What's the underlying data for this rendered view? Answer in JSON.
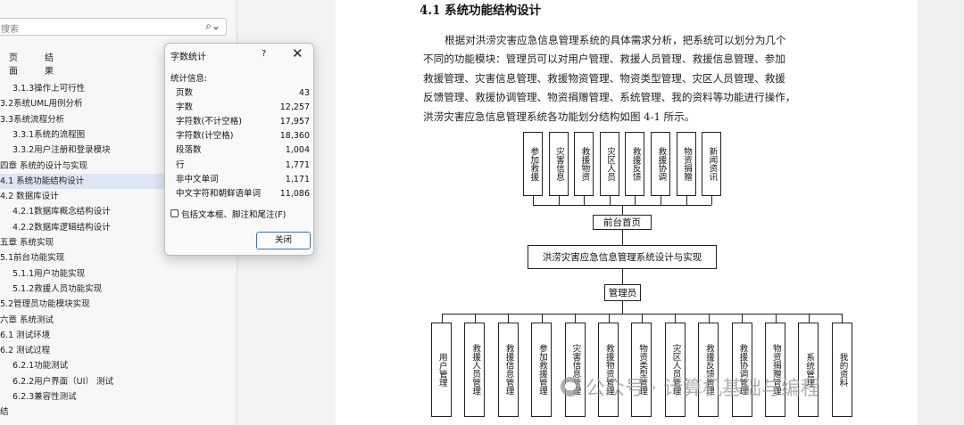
{
  "nav": {
    "search_placeholder": "搜索",
    "tabs": [
      "页面",
      "结果"
    ],
    "items": [
      {
        "label": "3.1.3操作上可行性",
        "indent": 14,
        "selected": false
      },
      {
        "label": "3.2系统UML用例分析",
        "indent": 0,
        "selected": false
      },
      {
        "label": "3.3系统流程分析",
        "indent": 0,
        "selected": false
      },
      {
        "label": "3.3.1系统的流程图",
        "indent": 14,
        "selected": false
      },
      {
        "label": "3.3.2用户注册和登录模块",
        "indent": 14,
        "selected": false
      },
      {
        "label": "四章 系统的设计与实现",
        "indent": 0,
        "selected": false
      },
      {
        "label": "4.1 系统功能结构设计",
        "indent": 0,
        "selected": true
      },
      {
        "label": "4.2 数据库设计",
        "indent": 0,
        "selected": false
      },
      {
        "label": "4.2.1数据库概念结构设计",
        "indent": 14,
        "selected": false
      },
      {
        "label": "4.2.2数据库逻辑结构设计",
        "indent": 14,
        "selected": false
      },
      {
        "label": "五章 系统实现",
        "indent": 0,
        "selected": false
      },
      {
        "label": "5.1前台功能实现",
        "indent": 0,
        "selected": false
      },
      {
        "label": "5.1.1用户功能实现",
        "indent": 14,
        "selected": false
      },
      {
        "label": "5.1.2救援人员功能实现",
        "indent": 14,
        "selected": false
      },
      {
        "label": "5.2管理员功能模块实现",
        "indent": 0,
        "selected": false
      },
      {
        "label": "六章 系统测试",
        "indent": 0,
        "selected": false
      },
      {
        "label": "6.1 测试环境",
        "indent": 0,
        "selected": false
      },
      {
        "label": "6.2 测试过程",
        "indent": 0,
        "selected": false
      },
      {
        "label": "6.2.1功能测试",
        "indent": 14,
        "selected": false
      },
      {
        "label": "6.2.2用户界面（UI） 测试",
        "indent": 14,
        "selected": false
      },
      {
        "label": "6.2.3兼容性测试",
        "indent": 14,
        "selected": false
      },
      {
        "label": "结",
        "indent": 0,
        "selected": false
      }
    ]
  },
  "dialog": {
    "title": "字数统计",
    "help": "?",
    "close": "✕",
    "section": "统计信息:",
    "stats": [
      {
        "label": "页数",
        "value": "43"
      },
      {
        "label": "字数",
        "value": "12,257"
      },
      {
        "label": "字符数(不计空格)",
        "value": "17,957"
      },
      {
        "label": "字符数(计空格)",
        "value": "18,360"
      },
      {
        "label": "段落数",
        "value": "1,004"
      },
      {
        "label": "行",
        "value": "1,771"
      },
      {
        "label": "非中文单词",
        "value": "1,171"
      },
      {
        "label": "中文字符和朝鲜语单词",
        "value": "11,086"
      }
    ],
    "checkbox_label": "包括文本框、脚注和尾注(F)",
    "checkbox_checked": false,
    "close_button": "关闭"
  },
  "document": {
    "heading": "4.1  系统功能结构设计",
    "paragraph_lines": [
      "根据对洪涝灾害应急信息管理系统的具体需求分析，把系统可以划分为几个",
      "不同的功能模块：管理员可以对用户管理、救援人员管理、救援信息管理、参加",
      "救援管理、灾害信息管理、救援物资管理、物资类型管理、灾区人员管理、救援",
      "反馈管理、救援协调管理、物资捐赠管理、系统管理、我的资料等功能进行操作，",
      "洪涝灾害应急信息管理系统各功能划分结构如图 4-1 所示。"
    ]
  },
  "diagram": {
    "top_modules": [
      "参加救援",
      "灾害信息",
      "救援物资",
      "灾区人员",
      "救援反馈",
      "救援协调",
      "物资捐赠",
      "新闻资讯"
    ],
    "front_node": "前台首页",
    "root_node": "洪涝灾害应急信息管理系统设计与实现",
    "admin_node": "管理员",
    "bottom_modules": [
      "用户管理",
      "救援人员管理",
      "救援信息管理",
      "参加救援管理",
      "灾害信息管理",
      "救援物资管理",
      "物资类型管理",
      "灾区人员管理",
      "救援反馈管理",
      "救援协调管理",
      "物资捐赠管理",
      "系统管理",
      "我的资料"
    ]
  },
  "watermark": "公众号 · 计算机基础与编程",
  "colors": {
    "selection": "#dce6f4",
    "button_border": "#3d6fb4"
  }
}
